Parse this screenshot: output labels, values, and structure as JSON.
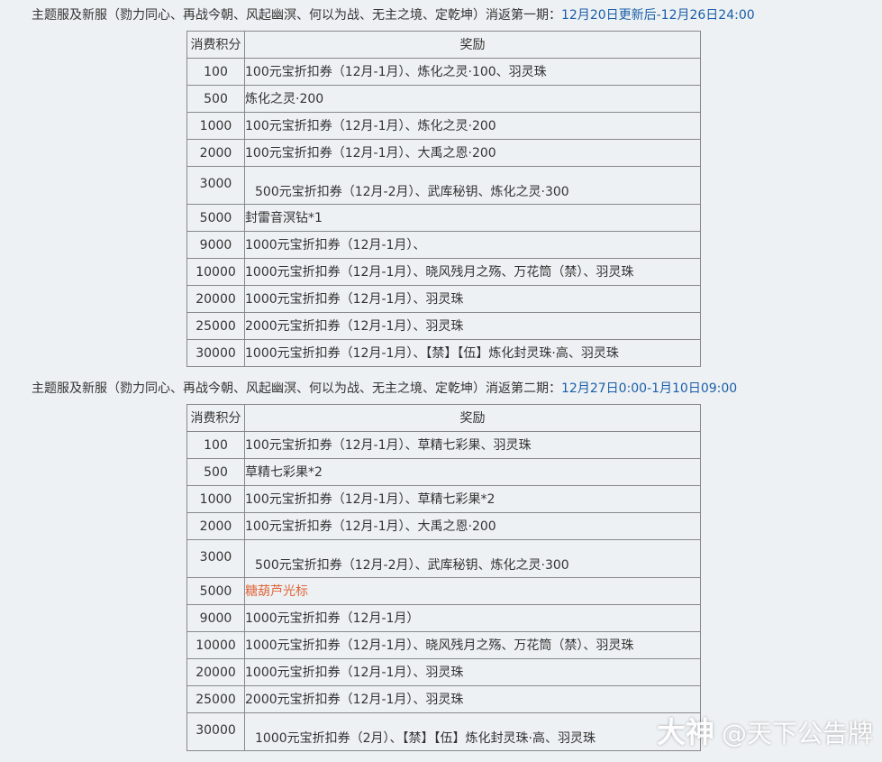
{
  "section1": {
    "title_prefix": "主题服及新服（勠力同心、再战今朝、风起幽溟、何以为战、无主之境、定乾坤）消返第一期：",
    "title_time": "12月20日更新后-12月26日24:00",
    "header_points": "消费积分",
    "header_reward": "奖励",
    "rows": [
      {
        "points": "100",
        "reward": "100元宝折扣券（12月-1月）、炼化之灵·100、羽灵珠"
      },
      {
        "points": "500",
        "reward": "炼化之灵·200"
      },
      {
        "points": "1000",
        "reward": "100元宝折扣券（12月-1月）、炼化之灵·200"
      },
      {
        "points": "2000",
        "reward": "100元宝折扣券（12月-1月）、大禹之恩·200"
      },
      {
        "points": "3000",
        "reward": "500元宝折扣券（12月-2月）、武库秘钥、炼化之灵·300"
      },
      {
        "points": "5000",
        "reward": "封雷音溟钻*1"
      },
      {
        "points": "9000",
        "reward": "1000元宝折扣券（12月-1月）、"
      },
      {
        "points": "10000",
        "reward": "1000元宝折扣券（12月-1月）、晓风残月之殇、万花筒（禁）、羽灵珠"
      },
      {
        "points": "20000",
        "reward": "1000元宝折扣券（12月-1月）、羽灵珠"
      },
      {
        "points": "25000",
        "reward": "2000元宝折扣券（12月-1月）、羽灵珠"
      },
      {
        "points": "30000",
        "reward": "1000元宝折扣券（12月-1月）、【禁】【伍】炼化封灵珠·高、羽灵珠"
      }
    ]
  },
  "section2": {
    "title_prefix": "主题服及新服（勠力同心、再战今朝、风起幽溟、何以为战、无主之境、定乾坤）消返第二期：",
    "title_time": "12月27日0:00-1月10日09:00",
    "header_points": "消费积分",
    "header_reward": "奖励",
    "rows": [
      {
        "points": "100",
        "reward": "100元宝折扣券（12月-1月）、草精七彩果、羽灵珠"
      },
      {
        "points": "500",
        "reward": "草精七彩果*2"
      },
      {
        "points": "1000",
        "reward": "100元宝折扣券（12月-1月）、草精七彩果*2"
      },
      {
        "points": "2000",
        "reward": "100元宝折扣券（12月-1月）、大禹之恩·200"
      },
      {
        "points": "3000",
        "reward": "500元宝折扣券（12月-2月）、武库秘钥、炼化之灵·300"
      },
      {
        "points": "5000",
        "reward": "糖葫芦光标"
      },
      {
        "points": "9000",
        "reward": "1000元宝折扣券（12月-1月）"
      },
      {
        "points": "10000",
        "reward": "1000元宝折扣券（12月-1月）、晓风残月之殇、万花筒（禁）、羽灵珠"
      },
      {
        "points": "20000",
        "reward": "1000元宝折扣券（12月-1月）、羽灵珠"
      },
      {
        "points": "25000",
        "reward": "2000元宝折扣券（12月-1月）、羽灵珠"
      },
      {
        "points": "30000",
        "reward": "1000元宝折扣券（2月）、【禁】【伍】炼化封灵珠·高、羽灵珠"
      }
    ]
  },
  "watermark": {
    "logo": "大神",
    "text": "@天下公告牌"
  },
  "colors": {
    "highlight_time": "#1a5ea8",
    "highlight_reward": "#e0663a",
    "background": "#eef1f3",
    "border": "#888888"
  }
}
